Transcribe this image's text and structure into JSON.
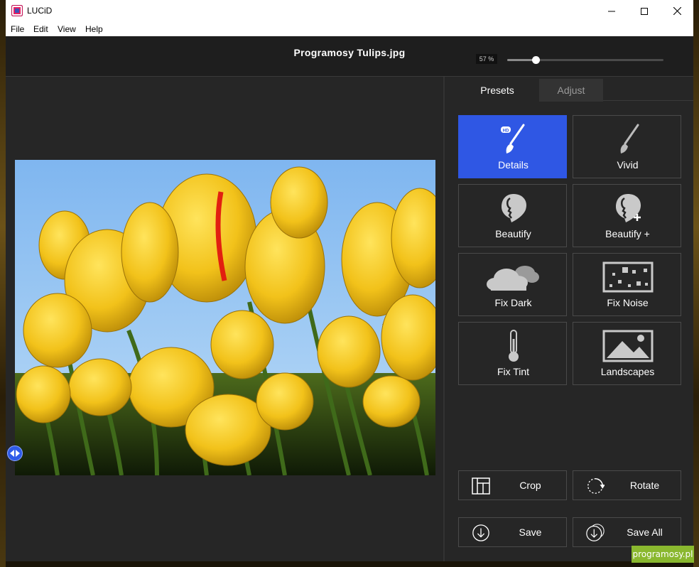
{
  "app": {
    "title": "LUCiD"
  },
  "menu": [
    "File",
    "Edit",
    "View",
    "Help"
  ],
  "header": {
    "filename": "Programosy Tulips.jpg",
    "zoom_label": "57 %",
    "zoom_fraction": 0.18
  },
  "tabs": {
    "presets": "Presets",
    "adjust": "Adjust"
  },
  "presets": [
    {
      "label": "Details",
      "icon": "hd-brush-icon",
      "active": true
    },
    {
      "label": "Vivid",
      "icon": "brush-icon",
      "active": false
    },
    {
      "label": "Beautify",
      "icon": "face-profile-icon",
      "active": false
    },
    {
      "label": "Beautify +",
      "icon": "face-profile-plus-icon",
      "active": false
    },
    {
      "label": "Fix Dark",
      "icon": "clouds-icon",
      "active": false
    },
    {
      "label": "Fix Noise",
      "icon": "noise-icon",
      "active": false
    },
    {
      "label": "Fix Tint",
      "icon": "thermometer-icon",
      "active": false
    },
    {
      "label": "Landscapes",
      "icon": "landscape-icon",
      "active": false
    }
  ],
  "actions": {
    "crop": {
      "label": "Crop",
      "icon": "crop-icon"
    },
    "rotate": {
      "label": "Rotate",
      "icon": "rotate-icon"
    },
    "save": {
      "label": "Save",
      "icon": "save-icon"
    },
    "save_all": {
      "label": "Save All",
      "icon": "save-all-icon"
    }
  },
  "watermark": "programosy.pl",
  "colors": {
    "accent": "#2f57e4",
    "panel": "#262626",
    "header": "#1e1e1e",
    "border": "#4a4a4a"
  }
}
